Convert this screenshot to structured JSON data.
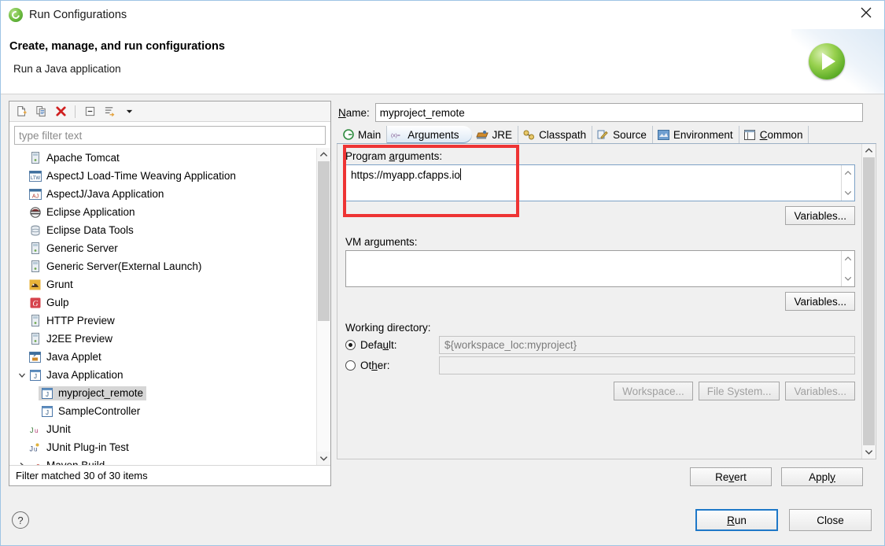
{
  "window": {
    "title": "Run Configurations",
    "icon": "eclipse-logo-icon",
    "close_label": "✕"
  },
  "header": {
    "title": "Create, manage, and run configurations",
    "subtitle": "Run a Java application",
    "banner_icon": "run-play-icon"
  },
  "tree_toolbar": {
    "buttons": [
      {
        "name": "new-configuration",
        "icon": "new-document-icon"
      },
      {
        "name": "duplicate-configuration",
        "icon": "copy-icon"
      },
      {
        "name": "delete-configuration",
        "icon": "delete-x-icon"
      },
      {
        "name": "collapse-all",
        "icon": "collapse-all-icon"
      },
      {
        "name": "filter-configurations",
        "icon": "filter-icon"
      },
      {
        "name": "view-menu",
        "icon": "chevron-down-icon"
      }
    ]
  },
  "filter": {
    "placeholder": "type filter text",
    "value": ""
  },
  "tree": {
    "items": [
      {
        "label": "Apache Tomcat",
        "icon": "server-icon",
        "depth": 0,
        "expandable": false,
        "selected": false
      },
      {
        "label": "AspectJ Load-Time Weaving Application",
        "icon": "ltw-icon",
        "depth": 0,
        "expandable": false,
        "selected": false
      },
      {
        "label": "AspectJ/Java Application",
        "icon": "aj-icon",
        "depth": 0,
        "expandable": false,
        "selected": false
      },
      {
        "label": "Eclipse Application",
        "icon": "eclipse-app-icon",
        "depth": 0,
        "expandable": false,
        "selected": false
      },
      {
        "label": "Eclipse Data Tools",
        "icon": "database-icon",
        "depth": 0,
        "expandable": false,
        "selected": false
      },
      {
        "label": "Generic Server",
        "icon": "server-icon",
        "depth": 0,
        "expandable": false,
        "selected": false
      },
      {
        "label": "Generic Server(External Launch)",
        "icon": "server-icon",
        "depth": 0,
        "expandable": false,
        "selected": false
      },
      {
        "label": "Grunt",
        "icon": "grunt-icon",
        "depth": 0,
        "expandable": false,
        "selected": false
      },
      {
        "label": "Gulp",
        "icon": "gulp-icon",
        "depth": 0,
        "expandable": false,
        "selected": false
      },
      {
        "label": "HTTP Preview",
        "icon": "server-icon",
        "depth": 0,
        "expandable": false,
        "selected": false
      },
      {
        "label": "J2EE Preview",
        "icon": "server-icon",
        "depth": 0,
        "expandable": false,
        "selected": false
      },
      {
        "label": "Java Applet",
        "icon": "applet-icon",
        "depth": 0,
        "expandable": false,
        "selected": false
      },
      {
        "label": "Java Application",
        "icon": "java-app-icon",
        "depth": 0,
        "expandable": true,
        "expanded": true,
        "selected": false
      },
      {
        "label": "myproject_remote",
        "icon": "java-app-icon",
        "depth": 1,
        "expandable": false,
        "selected": true
      },
      {
        "label": "SampleController",
        "icon": "java-app-icon",
        "depth": 1,
        "expandable": false,
        "selected": false
      },
      {
        "label": "JUnit",
        "icon": "junit-icon",
        "depth": 0,
        "expandable": false,
        "selected": false
      },
      {
        "label": "JUnit Plug-in Test",
        "icon": "junit-plugin-icon",
        "depth": 0,
        "expandable": false,
        "selected": false
      },
      {
        "label": "Maven Build",
        "icon": "maven-icon",
        "depth": 0,
        "expandable": true,
        "expanded": false,
        "selected": false
      }
    ],
    "status": "Filter matched 30 of 30 items"
  },
  "config": {
    "name_label": "Name:",
    "name_value": "myproject_remote",
    "tabs": [
      {
        "label": "Main",
        "icon": "main-tab-icon",
        "active": false
      },
      {
        "label": "Arguments",
        "icon": "arguments-tab-icon",
        "active": true
      },
      {
        "label": "JRE",
        "icon": "jre-tab-icon",
        "active": false
      },
      {
        "label": "Classpath",
        "icon": "classpath-tab-icon",
        "active": false
      },
      {
        "label": "Source",
        "icon": "source-tab-icon",
        "active": false
      },
      {
        "label": "Environment",
        "icon": "environment-tab-icon",
        "active": false
      },
      {
        "label": "Common",
        "icon": "common-tab-icon",
        "active": false
      }
    ],
    "program_arguments": {
      "label": "Program arguments:",
      "value": "https://myapp.cfapps.io",
      "variables_button": "Variables...",
      "highlighted": true,
      "highlight_color": "#ee3434"
    },
    "vm_arguments": {
      "label": "VM arguments:",
      "value": "",
      "variables_button": "Variables..."
    },
    "working_directory": {
      "label": "Working directory:",
      "default_label": "Default:",
      "default_value": "${workspace_loc:myproject}",
      "default_selected": true,
      "other_label": "Other:",
      "other_value": "",
      "other_selected": false,
      "buttons": [
        {
          "label": "Workspace...",
          "enabled": false
        },
        {
          "label": "File System...",
          "enabled": false
        },
        {
          "label": "Variables...",
          "enabled": false
        }
      ]
    }
  },
  "actions": {
    "revert": "Revert",
    "apply": "Apply",
    "run": "Run",
    "close": "Close",
    "help_icon": "question-mark-icon"
  }
}
